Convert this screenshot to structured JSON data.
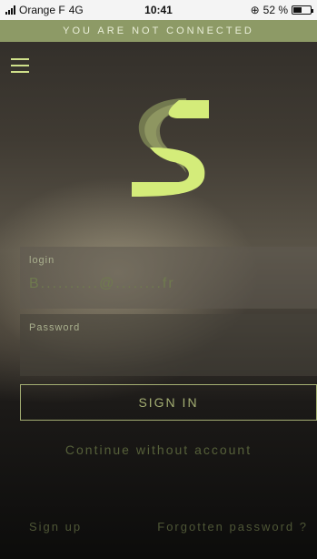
{
  "status_bar": {
    "carrier": "Orange F",
    "network": "4G",
    "time": "10:41",
    "battery": "52 %",
    "battery_level": 0.52
  },
  "banner": {
    "text": "YOU ARE NOT CONNECTED"
  },
  "colors": {
    "accent": "#cfe08a",
    "banner_bg": "#8d9a66",
    "button_border": "#a3ad72"
  },
  "form": {
    "login_label": "login",
    "login_value": "B..........@........fr",
    "password_label": "Password",
    "password_value": "",
    "signin_label": "SIGN IN"
  },
  "links": {
    "continue": "Continue without account",
    "signup": "Sign up",
    "forgot": "Forgotten password ?"
  }
}
